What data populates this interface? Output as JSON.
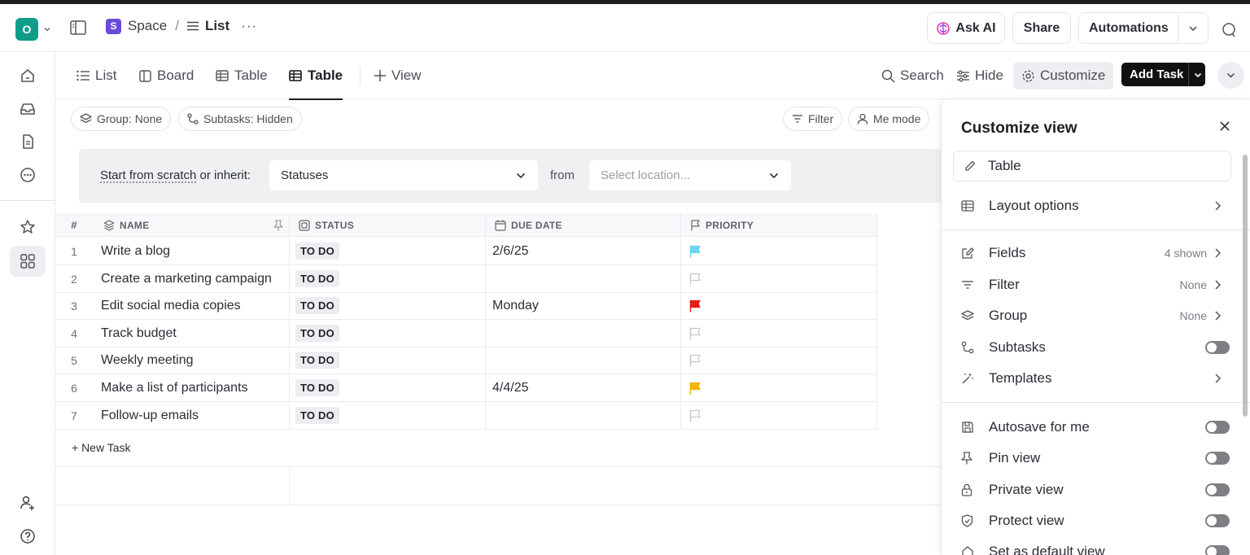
{
  "header": {
    "workspace_initial": "O",
    "space_badge": "S",
    "space_name": "Space",
    "separator": "/",
    "list_name": "List",
    "more": "···",
    "ask_ai": "Ask AI",
    "share": "Share",
    "automations": "Automations"
  },
  "tabs": [
    {
      "label": "List",
      "icon": "list-icon"
    },
    {
      "label": "Board",
      "icon": "board-icon"
    },
    {
      "label": "Table",
      "icon": "table-icon"
    },
    {
      "label": "Table",
      "icon": "table-icon",
      "active": true
    },
    {
      "label": "View",
      "icon": "plus-icon"
    }
  ],
  "toolbar": {
    "search": "Search",
    "hide": "Hide",
    "customize": "Customize",
    "add_task": "Add Task"
  },
  "chips": {
    "group": "Group: None",
    "subtasks": "Subtasks: Hidden",
    "filter": "Filter",
    "me_mode": "Me mode"
  },
  "banner": {
    "start_link": "Start from scratch",
    "inherit_text": " or inherit:",
    "statuses": "Statuses",
    "from": "from",
    "location_placeholder": "Select location..."
  },
  "table": {
    "columns": [
      "#",
      "NAME",
      "STATUS",
      "DUE DATE",
      "PRIORITY"
    ],
    "rows": [
      {
        "num": "1",
        "name": "Write a blog",
        "status": "TO DO",
        "due": "2/6/25",
        "priority": "low",
        "priority_color": "#6fd3f5"
      },
      {
        "num": "2",
        "name": "Create a marketing campaign",
        "status": "TO DO",
        "due": "",
        "priority": "none",
        "priority_color": ""
      },
      {
        "num": "3",
        "name": "Edit social media copies",
        "status": "TO DO",
        "due": "Monday",
        "priority": "urgent",
        "priority_color": "#e81919"
      },
      {
        "num": "4",
        "name": "Track budget",
        "status": "TO DO",
        "due": "",
        "priority": "none",
        "priority_color": ""
      },
      {
        "num": "5",
        "name": "Weekly meeting",
        "status": "TO DO",
        "due": "",
        "priority": "none",
        "priority_color": ""
      },
      {
        "num": "6",
        "name": "Make a list of participants",
        "status": "TO DO",
        "due": "4/4/25",
        "priority": "high",
        "priority_color": "#f2b600"
      },
      {
        "num": "7",
        "name": "Follow-up emails",
        "status": "TO DO",
        "due": "",
        "priority": "none",
        "priority_color": ""
      }
    ],
    "new_task": "+ New Task"
  },
  "panel": {
    "title": "Customize view",
    "view_name": "Table",
    "layout_options": "Layout options",
    "fields": "Fields",
    "fields_value": "4 shown",
    "filter": "Filter",
    "filter_value": "None",
    "group": "Group",
    "group_value": "None",
    "subtasks": "Subtasks",
    "templates": "Templates",
    "autosave": "Autosave for me",
    "pin_view": "Pin view",
    "private_view": "Private view",
    "protect_view": "Protect view",
    "default_view": "Set as default view"
  }
}
